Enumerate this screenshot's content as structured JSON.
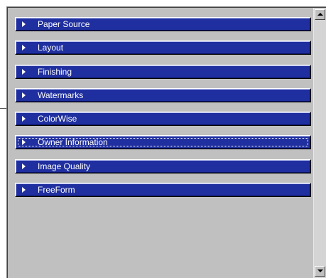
{
  "sections": [
    {
      "label": "Paper Source",
      "icon": "expand-arrow-icon"
    },
    {
      "label": "Layout",
      "icon": "expand-arrow-icon"
    },
    {
      "label": "Finishing",
      "icon": "expand-arrow-icon"
    },
    {
      "label": "Watermarks",
      "icon": "expand-arrow-icon"
    },
    {
      "label": "ColorWise",
      "icon": "expand-arrow-icon"
    },
    {
      "label": "Owner Information",
      "icon": "expand-arrow-icon",
      "focused": true
    },
    {
      "label": "Image Quality",
      "icon": "expand-arrow-icon"
    },
    {
      "label": "FreeForm",
      "icon": "expand-arrow-icon"
    }
  ],
  "colors": {
    "section_bar": "#1f2f9f",
    "panel_background": "#c0c0c0",
    "label_text": "#ffffff"
  }
}
